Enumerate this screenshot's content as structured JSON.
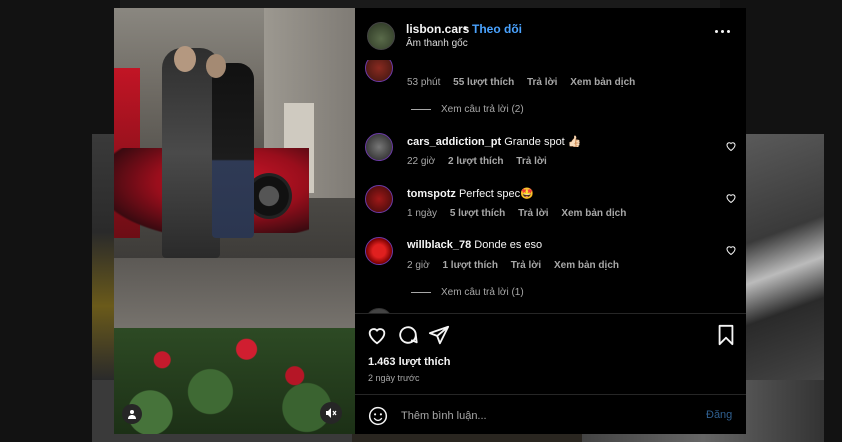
{
  "post": {
    "username": "lisbon.cars",
    "dot": "•",
    "follow_label": "Theo dõi",
    "audio": "Âm thanh gốc"
  },
  "comments": [
    {
      "user": "",
      "text": "",
      "meta": {
        "time": "53 phút",
        "likes": "55 lượt thích",
        "reply": "Trả lời",
        "translate": "Xem bản dịch"
      },
      "view_replies": "Xem câu trả lời (2)"
    },
    {
      "user": "cars_addiction_pt",
      "text": "Grande spot 👍🏻",
      "meta": {
        "time": "22 giờ",
        "likes": "2 lượt thích",
        "reply": "Trả lời"
      }
    },
    {
      "user": "tomspotz",
      "text": "Perfect spec🤩",
      "meta": {
        "time": "1 ngày",
        "likes": "5 lượt thích",
        "reply": "Trả lời",
        "translate": "Xem bản dịch"
      }
    },
    {
      "user": "willblack_78",
      "text": "Donde es eso",
      "meta": {
        "time": "2 giờ",
        "likes": "1 lượt thích",
        "reply": "Trả lời",
        "translate": "Xem bản dịch"
      },
      "view_replies": "Xem câu trả lời (1)"
    }
  ],
  "footer": {
    "likes": "1.463 lượt thích",
    "time_ago": "2 ngày trước",
    "comment_placeholder": "Thêm bình luận...",
    "post_label": "Đăng"
  },
  "icons": {
    "like": "heart-icon",
    "comment": "comment-icon",
    "share": "share-icon",
    "save": "bookmark-icon",
    "emoji": "emoji-icon",
    "more": "more-icon",
    "mute": "mute-icon",
    "tagged": "user-icon"
  },
  "colors": {
    "accent": "#4aa3ff",
    "panel": "#000000",
    "muted_text": "#a8a8a8"
  }
}
